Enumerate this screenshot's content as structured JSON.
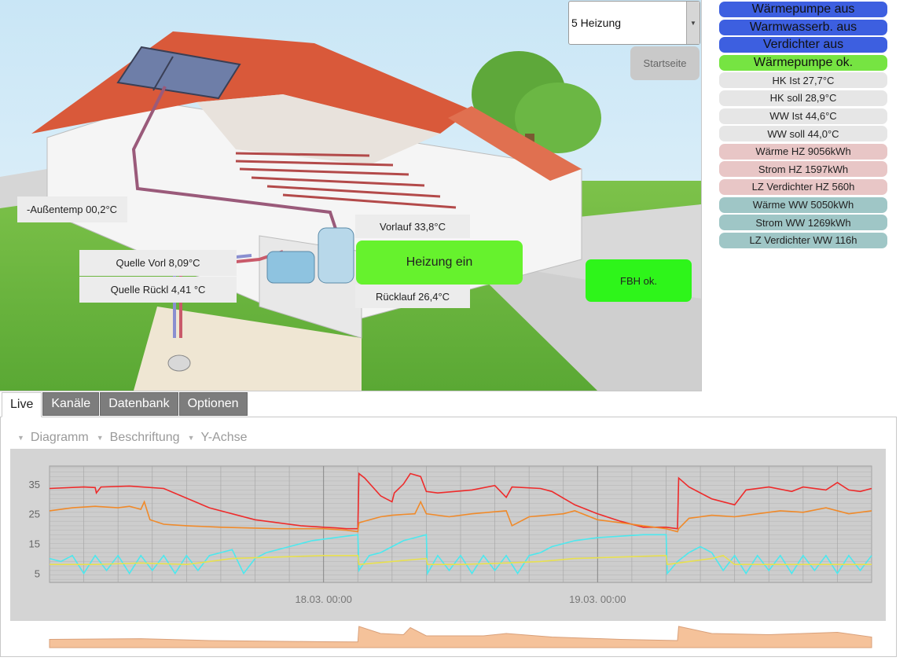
{
  "scene": {
    "outdoor_temp": "-Außentemp 00,2°C",
    "source_supply": "Quelle Vorl  8,09°C",
    "source_return": "Quelle Rückl 4,41  °C",
    "flow": "Vorlauf 33,8°C",
    "return": "Rücklauf 26,4°C",
    "heating_on": "Heizung ein",
    "floor_heating": "FBH ok."
  },
  "mode_select": {
    "value": "5 Heizung",
    "arrow_icon": "chevron-down-icon"
  },
  "start_button": "Startseite",
  "status": [
    {
      "label": "Wärmepumpe aus",
      "kind": "blue"
    },
    {
      "label": "Warmwasserb. aus",
      "kind": "blue"
    },
    {
      "label": "Verdichter aus",
      "kind": "blue"
    },
    {
      "label": "Wärmepumpe ok.",
      "kind": "green"
    },
    {
      "label": "HK Ist 27,7°C",
      "kind": "gray"
    },
    {
      "label": "HK soll 28,9°C",
      "kind": "gray"
    },
    {
      "label": "WW Ist 44,6°C",
      "kind": "gray"
    },
    {
      "label": "WW soll 44,0°C",
      "kind": "gray"
    },
    {
      "label": "Wärme HZ 9056kWh",
      "kind": "pink"
    },
    {
      "label": "Strom HZ 1597kWh",
      "kind": "pink"
    },
    {
      "label": "LZ Verdichter HZ 560h",
      "kind": "pink"
    },
    {
      "label": "Wärme WW 5050kWh",
      "kind": "teal"
    },
    {
      "label": "Strom WW 1269kWh",
      "kind": "teal"
    },
    {
      "label": "LZ Verdichter WW 116h",
      "kind": "teal"
    }
  ],
  "tabs": [
    "Live",
    "Kanäle",
    "Datenbank",
    "Optionen"
  ],
  "menus": [
    "Diagramm",
    "Beschriftung",
    "Y-Achse"
  ],
  "colors": {
    "accent_blue": "#3d5fe0",
    "ok_green": "#76e442",
    "series_red": "#ee2b2b",
    "series_orange": "#f08a2a",
    "series_cyan": "#4de8ee",
    "series_yellow": "#e8e050"
  },
  "chart_data": {
    "type": "line",
    "x_ticks": [
      {
        "t": 24,
        "label": "18.03. 00:00"
      },
      {
        "t": 48,
        "label": "19.03. 00:00"
      }
    ],
    "xlim": [
      0,
      55
    ],
    "ylim": [
      2,
      41
    ],
    "y_ticks": [
      5,
      15,
      25,
      35
    ],
    "grid": true,
    "legend": "none",
    "series": [
      {
        "color": "#ee2b2b",
        "points": [
          [
            0,
            33.5
          ],
          [
            3,
            34
          ],
          [
            4,
            33.8
          ],
          [
            4.1,
            32
          ],
          [
            4.5,
            34
          ],
          [
            7,
            34.3
          ],
          [
            10,
            33.5
          ],
          [
            14,
            27
          ],
          [
            18,
            23
          ],
          [
            22,
            21
          ],
          [
            24,
            20.5
          ],
          [
            25,
            20.3
          ],
          [
            26,
            20
          ],
          [
            27,
            20
          ],
          [
            27.1,
            38.5
          ],
          [
            27.6,
            37
          ],
          [
            29,
            31
          ],
          [
            30,
            29
          ],
          [
            30.2,
            32
          ],
          [
            31,
            35
          ],
          [
            31.6,
            38.5
          ],
          [
            32.5,
            37.5
          ],
          [
            33,
            32.5
          ],
          [
            34,
            32
          ],
          [
            37,
            33
          ],
          [
            39,
            34.5
          ],
          [
            40,
            30.5
          ],
          [
            40.5,
            34
          ],
          [
            43,
            33.5
          ],
          [
            44,
            32.5
          ],
          [
            46,
            28
          ],
          [
            48,
            25
          ],
          [
            50,
            22.5
          ],
          [
            52,
            20.5
          ],
          [
            54,
            20.5
          ],
          [
            55,
            20
          ],
          [
            55.1,
            37
          ],
          [
            56,
            34
          ],
          [
            58,
            30
          ],
          [
            60,
            28
          ],
          [
            61,
            33
          ],
          [
            63,
            34
          ],
          [
            65,
            32.5
          ],
          [
            66,
            34
          ],
          [
            68,
            33
          ],
          [
            69,
            35.5
          ],
          [
            70,
            33
          ],
          [
            71,
            32.5
          ],
          [
            72,
            33.5
          ]
        ]
      },
      {
        "color": "#f08a2a",
        "points": [
          [
            0,
            26
          ],
          [
            2,
            27
          ],
          [
            4,
            27.5
          ],
          [
            6,
            27
          ],
          [
            7,
            27.5
          ],
          [
            8,
            26.5
          ],
          [
            8.3,
            29
          ],
          [
            8.8,
            23
          ],
          [
            10,
            21.5
          ],
          [
            12,
            21
          ],
          [
            15,
            20.5
          ],
          [
            20,
            20
          ],
          [
            24,
            20
          ],
          [
            26,
            19.5
          ],
          [
            27,
            19
          ],
          [
            27.1,
            22
          ],
          [
            29,
            24
          ],
          [
            30,
            24.5
          ],
          [
            31,
            24.8
          ],
          [
            32,
            25
          ],
          [
            32.5,
            29
          ],
          [
            33,
            25
          ],
          [
            35,
            24
          ],
          [
            37,
            25
          ],
          [
            40,
            26
          ],
          [
            40.5,
            21
          ],
          [
            42,
            24
          ],
          [
            45,
            25
          ],
          [
            46,
            26
          ],
          [
            48,
            23
          ],
          [
            50,
            22
          ],
          [
            52,
            21
          ],
          [
            54,
            20
          ],
          [
            55,
            19
          ],
          [
            55.1,
            20
          ],
          [
            56,
            23.5
          ],
          [
            58,
            24.5
          ],
          [
            60,
            24
          ],
          [
            62,
            25
          ],
          [
            64,
            26
          ],
          [
            66,
            25.5
          ],
          [
            68,
            27
          ],
          [
            70,
            25
          ],
          [
            72,
            26
          ]
        ]
      },
      {
        "color": "#4de8ee",
        "points": [
          [
            0,
            10
          ],
          [
            1,
            9
          ],
          [
            2,
            11
          ],
          [
            3,
            5
          ],
          [
            4,
            11
          ],
          [
            5,
            6
          ],
          [
            6,
            11
          ],
          [
            7,
            5
          ],
          [
            8,
            11
          ],
          [
            9,
            6
          ],
          [
            10,
            11
          ],
          [
            11,
            5
          ],
          [
            12,
            11
          ],
          [
            13,
            6
          ],
          [
            14,
            11
          ],
          [
            15,
            12
          ],
          [
            16,
            13
          ],
          [
            17,
            5
          ],
          [
            18,
            10
          ],
          [
            19,
            12
          ],
          [
            21,
            14
          ],
          [
            23,
            16
          ],
          [
            25,
            17
          ],
          [
            27,
            18
          ],
          [
            27.1,
            6
          ],
          [
            28,
            11
          ],
          [
            29,
            12
          ],
          [
            30,
            14
          ],
          [
            31,
            16
          ],
          [
            32,
            17
          ],
          [
            33,
            18
          ],
          [
            33.1,
            5
          ],
          [
            34,
            11
          ],
          [
            35,
            6
          ],
          [
            36,
            11
          ],
          [
            37,
            5
          ],
          [
            38,
            11
          ],
          [
            39,
            6
          ],
          [
            40,
            11
          ],
          [
            41,
            5
          ],
          [
            42,
            11
          ],
          [
            43,
            12
          ],
          [
            44,
            14
          ],
          [
            46,
            16
          ],
          [
            48,
            17
          ],
          [
            50,
            17.5
          ],
          [
            52,
            18
          ],
          [
            54,
            18
          ],
          [
            54.1,
            5
          ],
          [
            55,
            9
          ],
          [
            56,
            12
          ],
          [
            57,
            14
          ],
          [
            58,
            12
          ],
          [
            59,
            6
          ],
          [
            60,
            11
          ],
          [
            61,
            5
          ],
          [
            62,
            11
          ],
          [
            63,
            6
          ],
          [
            64,
            11
          ],
          [
            65,
            5
          ],
          [
            66,
            11
          ],
          [
            67,
            6
          ],
          [
            68,
            11
          ],
          [
            69,
            5
          ],
          [
            70,
            11
          ],
          [
            71,
            6
          ],
          [
            72,
            11
          ]
        ]
      },
      {
        "color": "#e8e050",
        "points": [
          [
            0,
            8
          ],
          [
            4,
            8
          ],
          [
            8,
            8.5
          ],
          [
            12,
            8
          ],
          [
            14,
            9
          ],
          [
            16,
            10
          ],
          [
            20,
            10.5
          ],
          [
            24,
            11
          ],
          [
            27,
            11
          ],
          [
            27.1,
            8
          ],
          [
            30,
            9
          ],
          [
            33,
            10
          ],
          [
            33.1,
            8
          ],
          [
            36,
            8
          ],
          [
            40,
            8.5
          ],
          [
            43,
            9
          ],
          [
            46,
            10
          ],
          [
            50,
            10.5
          ],
          [
            54,
            11
          ],
          [
            54.1,
            8
          ],
          [
            56,
            9
          ],
          [
            58,
            10
          ],
          [
            59,
            11
          ],
          [
            60,
            8
          ],
          [
            64,
            8
          ],
          [
            68,
            8
          ],
          [
            72,
            8
          ]
        ]
      }
    ],
    "navigator": {
      "color": "#f5c29a",
      "points": [
        [
          0,
          0.35
        ],
        [
          8,
          0.38
        ],
        [
          14,
          0.3
        ],
        [
          24,
          0.25
        ],
        [
          27,
          0.24
        ],
        [
          27.1,
          0.9
        ],
        [
          29,
          0.6
        ],
        [
          31,
          0.55
        ],
        [
          31.6,
          0.85
        ],
        [
          33,
          0.5
        ],
        [
          38,
          0.5
        ],
        [
          40,
          0.6
        ],
        [
          44,
          0.45
        ],
        [
          50,
          0.35
        ],
        [
          55,
          0.3
        ],
        [
          55.1,
          0.9
        ],
        [
          58,
          0.6
        ],
        [
          63,
          0.55
        ],
        [
          66,
          0.6
        ],
        [
          69,
          0.65
        ],
        [
          72,
          0.45
        ]
      ]
    }
  }
}
